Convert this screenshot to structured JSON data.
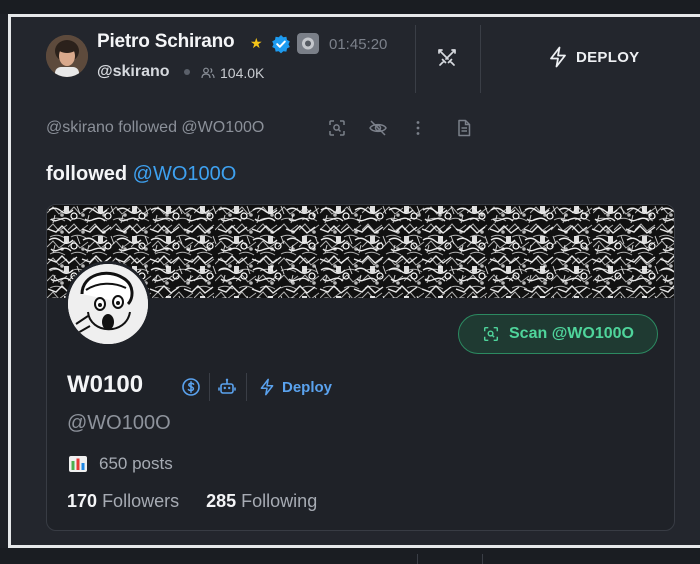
{
  "header": {
    "author_name": "Pietro Schirano",
    "star_glyph": "★",
    "timestamp": "01:45:20",
    "handle": "@skirano",
    "follower_count": "104.0K",
    "deploy_label": "DEPLOY"
  },
  "activity": {
    "text": "@skirano followed @WO100O"
  },
  "headline": {
    "verb": "followed",
    "target": "@WO100O"
  },
  "card": {
    "scan_label": "Scan @WO100O",
    "display_name": "W0100",
    "deploy_label": "Deploy",
    "handle": "@WO100O",
    "posts_label": "650 posts",
    "followers_count": "170",
    "followers_label": "Followers",
    "following_count": "285",
    "following_label": "Following"
  },
  "icons": [
    "verified-icon",
    "star-icon",
    "users-icon",
    "crossed-swords-icon",
    "lightning-icon",
    "scan-icon",
    "eye-off-icon",
    "more-vertical-icon",
    "document-icon",
    "dollar-icon",
    "robot-icon",
    "bar-chart-icon"
  ],
  "colors": {
    "accent_blue": "#3ea1f0",
    "scan_green": "#4fd49b",
    "deploy_blue": "#5aa2ee",
    "background": "#23262d"
  }
}
